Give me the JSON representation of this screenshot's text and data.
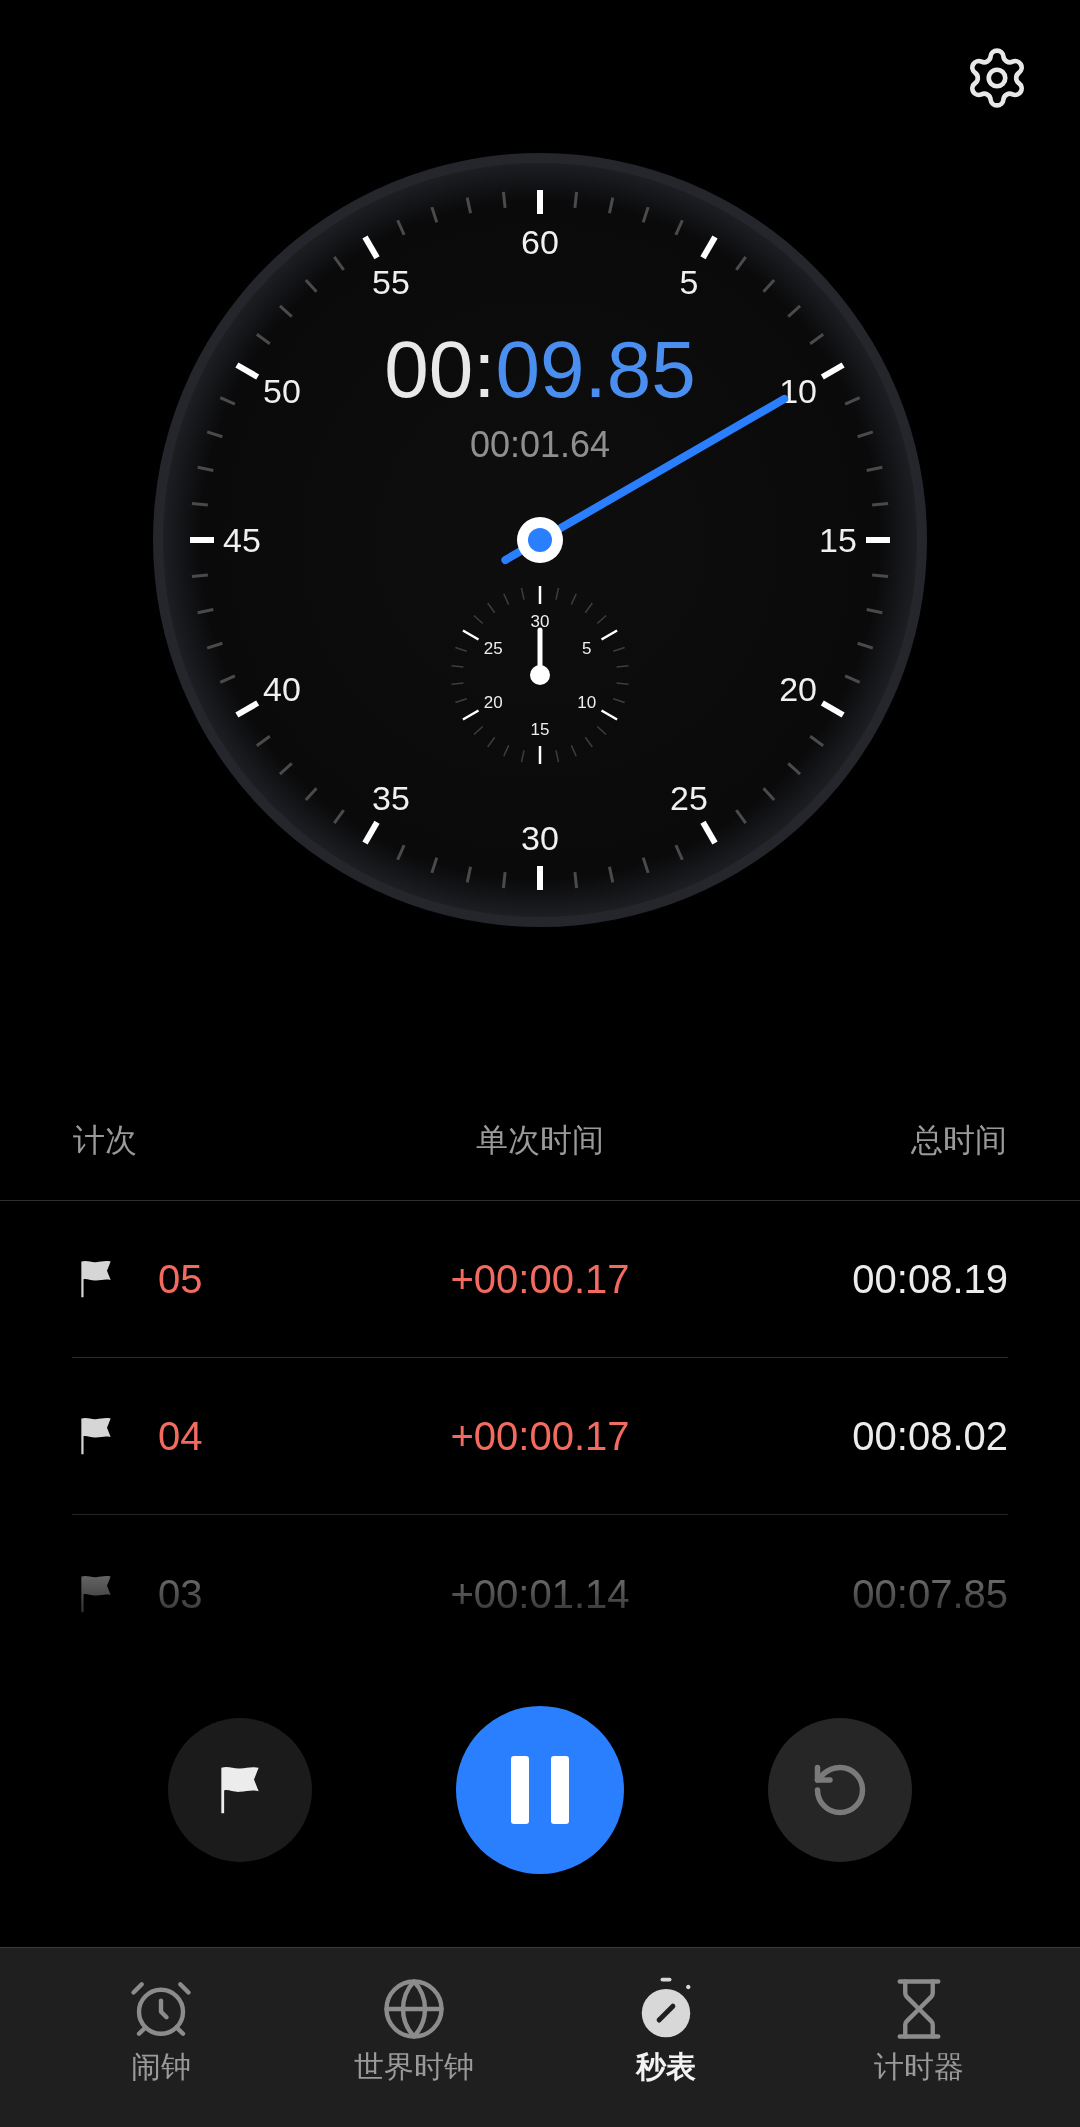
{
  "dial": {
    "numbers": [
      "60",
      "5",
      "10",
      "15",
      "20",
      "25",
      "30",
      "35",
      "40",
      "45",
      "50",
      "55"
    ],
    "elapsed": {
      "minutes": "00:",
      "seconds": "09.85"
    },
    "lap_time": "00:01.64",
    "subdial": {
      "numbers": [
        "30",
        "5",
        "10",
        "15",
        "20",
        "25"
      ]
    }
  },
  "lap_table": {
    "columns": [
      "计次",
      "单次时间",
      "总时间"
    ],
    "rows": [
      {
        "number": "05",
        "split": "+00:00.17",
        "total": "00:08.19",
        "highlight": true
      },
      {
        "number": "04",
        "split": "+00:00.17",
        "total": "00:08.02",
        "highlight": true
      },
      {
        "number": "03",
        "split": "+00:01.14",
        "total": "00:07.85",
        "highlight": false
      }
    ]
  },
  "controls": [
    {
      "kind": "lap",
      "disabled": false
    },
    {
      "kind": "pause",
      "disabled": false
    },
    {
      "kind": "reset",
      "disabled": true
    }
  ],
  "tab_bar": [
    {
      "kind": "alarm",
      "label": "闹钟",
      "selected": false
    },
    {
      "kind": "world",
      "label": "世界时钟",
      "selected": false
    },
    {
      "kind": "stopwatch",
      "label": "秒表",
      "selected": true
    },
    {
      "kind": "timer",
      "label": "计时器",
      "selected": false
    }
  ]
}
